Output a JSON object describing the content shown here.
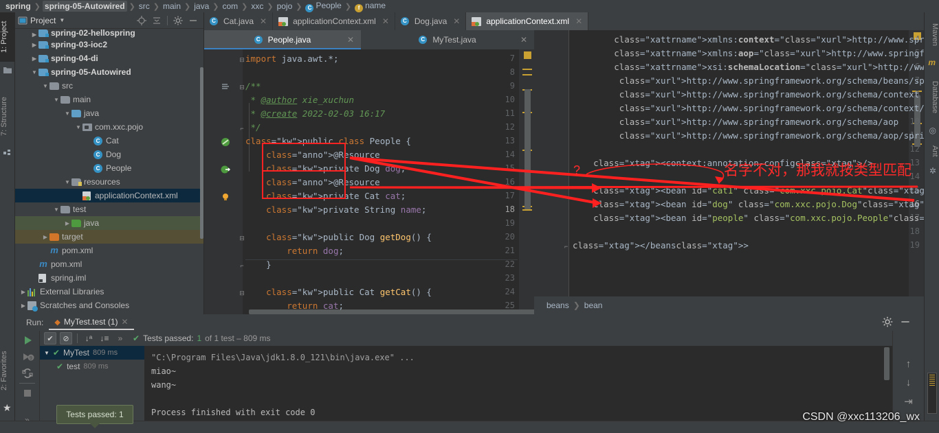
{
  "breadcrumb": {
    "items": [
      {
        "label": "spring",
        "bold": true,
        "icon": ""
      },
      {
        "label": "spring-05-Autowired",
        "bold": true,
        "icon": "",
        "selected": true
      },
      {
        "label": "src",
        "icon": ""
      },
      {
        "label": "main",
        "icon": ""
      },
      {
        "label": "java",
        "icon": ""
      },
      {
        "label": "com",
        "icon": ""
      },
      {
        "label": "xxc",
        "icon": ""
      },
      {
        "label": "pojo",
        "icon": ""
      },
      {
        "label": "People",
        "icon": "class-icon"
      },
      {
        "label": "name",
        "icon": "field-icon"
      }
    ]
  },
  "left_tool_tabs": [
    {
      "label": "1: Project",
      "active": true
    },
    {
      "label": "7: Structure",
      "active": false
    },
    {
      "label": "2: Favorites",
      "active": false
    }
  ],
  "right_tool_tabs": [
    {
      "label": "Maven"
    },
    {
      "label": "Database"
    },
    {
      "label": "Ant"
    }
  ],
  "project_panel": {
    "title": "Project",
    "toolbar_icons": [
      "locate-icon",
      "collapse-all-icon",
      "gear-icon",
      "minimize-icon"
    ],
    "tree": [
      {
        "label": "spring-02-hellospring",
        "depth": 1,
        "arrow": "right",
        "icon": "module-folder",
        "bold": true,
        "clipped": true
      },
      {
        "label": "spring-03-ioc2",
        "depth": 1,
        "arrow": "right",
        "icon": "module-folder",
        "bold": true
      },
      {
        "label": "spring-04-di",
        "depth": 1,
        "arrow": "right",
        "icon": "module-folder",
        "bold": true
      },
      {
        "label": "spring-05-Autowired",
        "depth": 1,
        "arrow": "down",
        "icon": "module-folder",
        "bold": true
      },
      {
        "label": "src",
        "depth": 2,
        "arrow": "down",
        "icon": "folder"
      },
      {
        "label": "main",
        "depth": 3,
        "arrow": "down",
        "icon": "folder"
      },
      {
        "label": "java",
        "depth": 4,
        "arrow": "down",
        "icon": "source-folder"
      },
      {
        "label": "com.xxc.pojo",
        "depth": 5,
        "arrow": "down",
        "icon": "package"
      },
      {
        "label": "Cat",
        "depth": 6,
        "arrow": "none",
        "icon": "class-icon"
      },
      {
        "label": "Dog",
        "depth": 6,
        "arrow": "none",
        "icon": "class-icon"
      },
      {
        "label": "People",
        "depth": 6,
        "arrow": "none",
        "icon": "class-icon"
      },
      {
        "label": "resources",
        "depth": 4,
        "arrow": "down",
        "icon": "resource-folder"
      },
      {
        "label": "applicationContext.xml",
        "depth": 5,
        "arrow": "none",
        "icon": "xml-icon",
        "highlight": "blue"
      },
      {
        "label": "test",
        "depth": 3,
        "arrow": "down",
        "icon": "folder"
      },
      {
        "label": "java",
        "depth": 4,
        "arrow": "right",
        "icon": "test-source-folder",
        "highlight": "green"
      },
      {
        "label": "target",
        "depth": 2,
        "arrow": "right",
        "icon": "target-folder",
        "highlight": "olive"
      },
      {
        "label": "pom.xml",
        "depth": 2,
        "arrow": "none",
        "icon": "maven-icon"
      },
      {
        "label": "pom.xml",
        "depth": 1,
        "arrow": "none",
        "icon": "maven-icon"
      },
      {
        "label": "spring.iml",
        "depth": 1,
        "arrow": "none",
        "icon": "iml-icon"
      },
      {
        "label": "External Libraries",
        "depth": 0,
        "arrow": "right",
        "icon": "library-icon"
      },
      {
        "label": "Scratches and Consoles",
        "depth": 0,
        "arrow": "right",
        "icon": "scratch-icon"
      }
    ]
  },
  "editor_tabs_row1": [
    {
      "label": "Cat.java",
      "icon": "class-icon",
      "active": false
    },
    {
      "label": "applicationContext.xml",
      "icon": "xml-icon",
      "active": false
    },
    {
      "label": "Dog.java",
      "icon": "class-icon",
      "active": false
    },
    {
      "label": "applicationContext.xml",
      "icon": "xml-icon",
      "active": true
    }
  ],
  "editor_tabs_row2": [
    {
      "label": "People.java",
      "icon": "class-icon",
      "active": true
    },
    {
      "label": "MyTest.java",
      "icon": "test-class-icon",
      "active": false
    }
  ],
  "java_editor": {
    "file": "People.java",
    "first_line": 7,
    "lines": [
      {
        "n": 7,
        "text": "import java.awt.*;",
        "fold": "minus"
      },
      {
        "n": 8,
        "text": ""
      },
      {
        "n": 9,
        "text": "/**",
        "fold": "minus",
        "gutter": "bookmark"
      },
      {
        "n": 10,
        "text": " * @author xie_xuchun"
      },
      {
        "n": 11,
        "text": " * @create 2022-02-03 16:17"
      },
      {
        "n": 12,
        "text": " */",
        "fold": "end"
      },
      {
        "n": 13,
        "text": "public class People {",
        "gutter": "bean-icon"
      },
      {
        "n": 14,
        "text": "    @Resource"
      },
      {
        "n": 15,
        "text": "    private Dog dog;",
        "gutter": "autowired-icon"
      },
      {
        "n": 16,
        "text": "    @Resource"
      },
      {
        "n": 17,
        "text": "    private Cat cat;",
        "gutter": "bulb-icon"
      },
      {
        "n": 18,
        "text": "    private String name;",
        "current": true
      },
      {
        "n": 19,
        "text": ""
      },
      {
        "n": 20,
        "text": "    public Dog getDog() {",
        "fold": "minus"
      },
      {
        "n": 21,
        "text": "        return dog;"
      },
      {
        "n": 22,
        "text": "    }",
        "fold": "end"
      },
      {
        "n": 23,
        "text": ""
      },
      {
        "n": 24,
        "text": "    public Cat getCat() {",
        "fold": "minus"
      },
      {
        "n": 25,
        "text": "        return cat;"
      }
    ]
  },
  "xml_editor": {
    "file": "applicationContext.xml",
    "lines": [
      {
        "n": 4,
        "text": "        xmlns:context=\"http://www.springframework.org/schema/context\""
      },
      {
        "n": 5,
        "text": "        xmlns:aop=\"http://www.springframework.org/schema/aop\""
      },
      {
        "n": 6,
        "text": "        xsi:schemaLocation=\"http://www.springframework.org/schema/beans"
      },
      {
        "n": 7,
        "text": "         http://www.springframework.org/schema/beans/spring-beans.xsd"
      },
      {
        "n": 8,
        "text": "         http://www.springframework.org/schema/context"
      },
      {
        "n": 9,
        "text": "         http://www.springframework.org/schema/context/spring-context.xsd"
      },
      {
        "n": 10,
        "text": "         http://www.springframework.org/schema/aop"
      },
      {
        "n": 11,
        "text": "         http://www.springframework.org/schema/aop/spring-aop.xsd\">"
      },
      {
        "n": 12,
        "text": ""
      },
      {
        "n": 13,
        "text": "    <context:annotation-config/>"
      },
      {
        "n": 14,
        "text": ""
      },
      {
        "n": 15,
        "text": "    <bean id=\"cat1\" class=\"com.xxc.pojo.Cat\"/>"
      },
      {
        "n": 16,
        "text": "    <bean id=\"dog\" class=\"com.xxc.pojo.Dog\"/>",
        "current": true
      },
      {
        "n": 17,
        "text": "    <bean id=\"people\" class=\"com.xxc.pojo.People\"/>"
      },
      {
        "n": 18,
        "text": ""
      },
      {
        "n": 19,
        "text": "</beans>",
        "fold": "end"
      }
    ],
    "breadcrumb": [
      "beans",
      "bean"
    ]
  },
  "annotations": {
    "chinese_note": "名字不对，那我就按类型匹配",
    "question_mark": "?",
    "color": "#ff2b2b"
  },
  "run_panel": {
    "run_label": "Run:",
    "tab_label": "MyTest.test (1)",
    "status_text_prefix": "Tests passed:",
    "status_count": "1",
    "status_suffix": "of 1 test – 809 ms",
    "toolbar_icons": [
      "rerun-icon",
      "rerun-failed-icon",
      "toggle-autotest-icon",
      "stop-icon",
      "more-icon"
    ],
    "filter_icons": [
      "show-passed-icon",
      "show-ignored-icon",
      "sort-alphabetically-icon",
      "sort-duration-icon",
      "expand-more-icon"
    ],
    "tree": [
      {
        "label": "MyTest",
        "time": "809 ms",
        "depth": 0,
        "selected": true,
        "arrow": "down"
      },
      {
        "label": "test",
        "time": "809 ms",
        "depth": 1,
        "selected": false,
        "arrow": "none"
      }
    ],
    "console": [
      "\"C:\\Program Files\\Java\\jdk1.8.0_121\\bin\\java.exe\" ...",
      "miao~",
      "wang~",
      "Process finished with exit code 0"
    ],
    "right_icons": [
      "scroll-up-icon",
      "scroll-down-icon",
      "soft-wrap-icon"
    ],
    "settings_icon": "gear-icon",
    "minimize_icon": "minimize-icon",
    "tooltip": "Tests passed: 1"
  },
  "watermark": "CSDN @xxc113206_wx"
}
